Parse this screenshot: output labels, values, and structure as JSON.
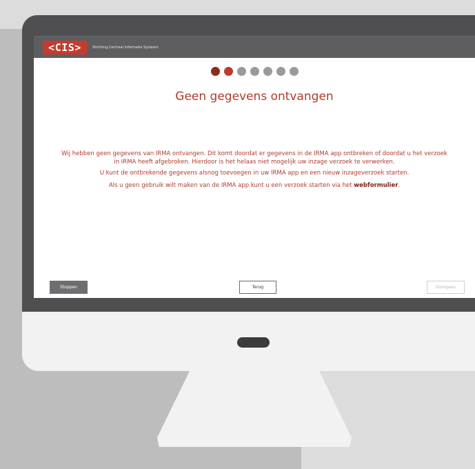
{
  "header": {
    "logo_text": "<CIS>",
    "organization": "Stichting Centraal Informatie Systeem"
  },
  "progress": {
    "total_steps": 7,
    "current_step": 2,
    "colors": {
      "done": "#8e2a1e",
      "current": "#c0392b",
      "todo": "#9a9a9a"
    }
  },
  "main": {
    "title": "Geen gegevens ontvangen",
    "paragraph1": "Wij hebben geen gegevens van IRMA ontvangen. Dit komt doordat er gegevens in de IRMA app ontbreken of doordat u het verzoek in IRMA heeft afgebroken. Hierdoor is het helaas niet mogelijk uw inzage verzoek te verwerken.",
    "paragraph2": "U kunt de ontbrekende gegevens alsnog toevoegen in uw IRMA app en een nieuw inzageverzoek starten.",
    "paragraph3_prefix": "Als u geen gebruik wilt maken van de IRMA app kunt u een verzoek starten via het ",
    "paragraph3_link": "webformulier",
    "paragraph3_suffix": "."
  },
  "footer": {
    "stop_label": "Stoppen",
    "back_label": "Terug",
    "next_label": "Doorgaan"
  },
  "colors": {
    "accent": "#c83a2e",
    "text_accent": "#b03a2c"
  }
}
